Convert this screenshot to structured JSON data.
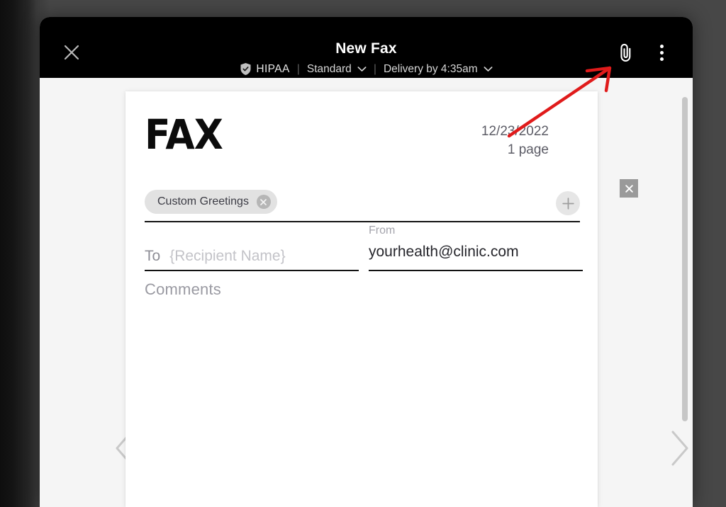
{
  "window": {
    "topbar": {
      "close_icon": "close-x-icon",
      "title": "New Fax",
      "compliance_badge": {
        "icon": "shield-check-icon",
        "label": "HIPAA"
      },
      "divider": "|",
      "speed_option": {
        "label": "Standard",
        "icon": "chevron-down-icon"
      },
      "delivery_option": {
        "label": "Delivery by 4:35am",
        "icon": "chevron-down-icon"
      },
      "attach_icon": "paperclip-icon",
      "overflow_icon": "more-vertical-icon"
    },
    "document": {
      "logo_text": "FAX",
      "date": "12/23/2022",
      "page_count": "1 page",
      "greeting_chip": {
        "label": "Custom Greetings",
        "remove_icon": "close-circle-icon"
      },
      "add_greeting_icon": "plus-icon",
      "to": {
        "label": "To",
        "placeholder": "{Recipient Name}",
        "value": ""
      },
      "from": {
        "label": "From",
        "value": "yourhealth@clinic.com"
      },
      "comments": {
        "label": "Comments",
        "value": ""
      },
      "close_icon": "close-x-icon"
    },
    "navigation": {
      "prev_icon": "chevron-left-icon",
      "next_icon": "chevron-right-icon"
    },
    "scrollbar": "vertical-scrollbar"
  },
  "annotation": {
    "arrow_icon": "red-arrow-pointer",
    "color": "#e01b1b",
    "points_to": "paperclip-icon"
  },
  "colors": {
    "topbar_bg": "#000000",
    "page_bg": "#f5f5f5",
    "paper_bg": "#ffffff",
    "chip_bg": "#e2e2e2",
    "accent_red": "#e01b1b",
    "backdrop": "#474747"
  }
}
